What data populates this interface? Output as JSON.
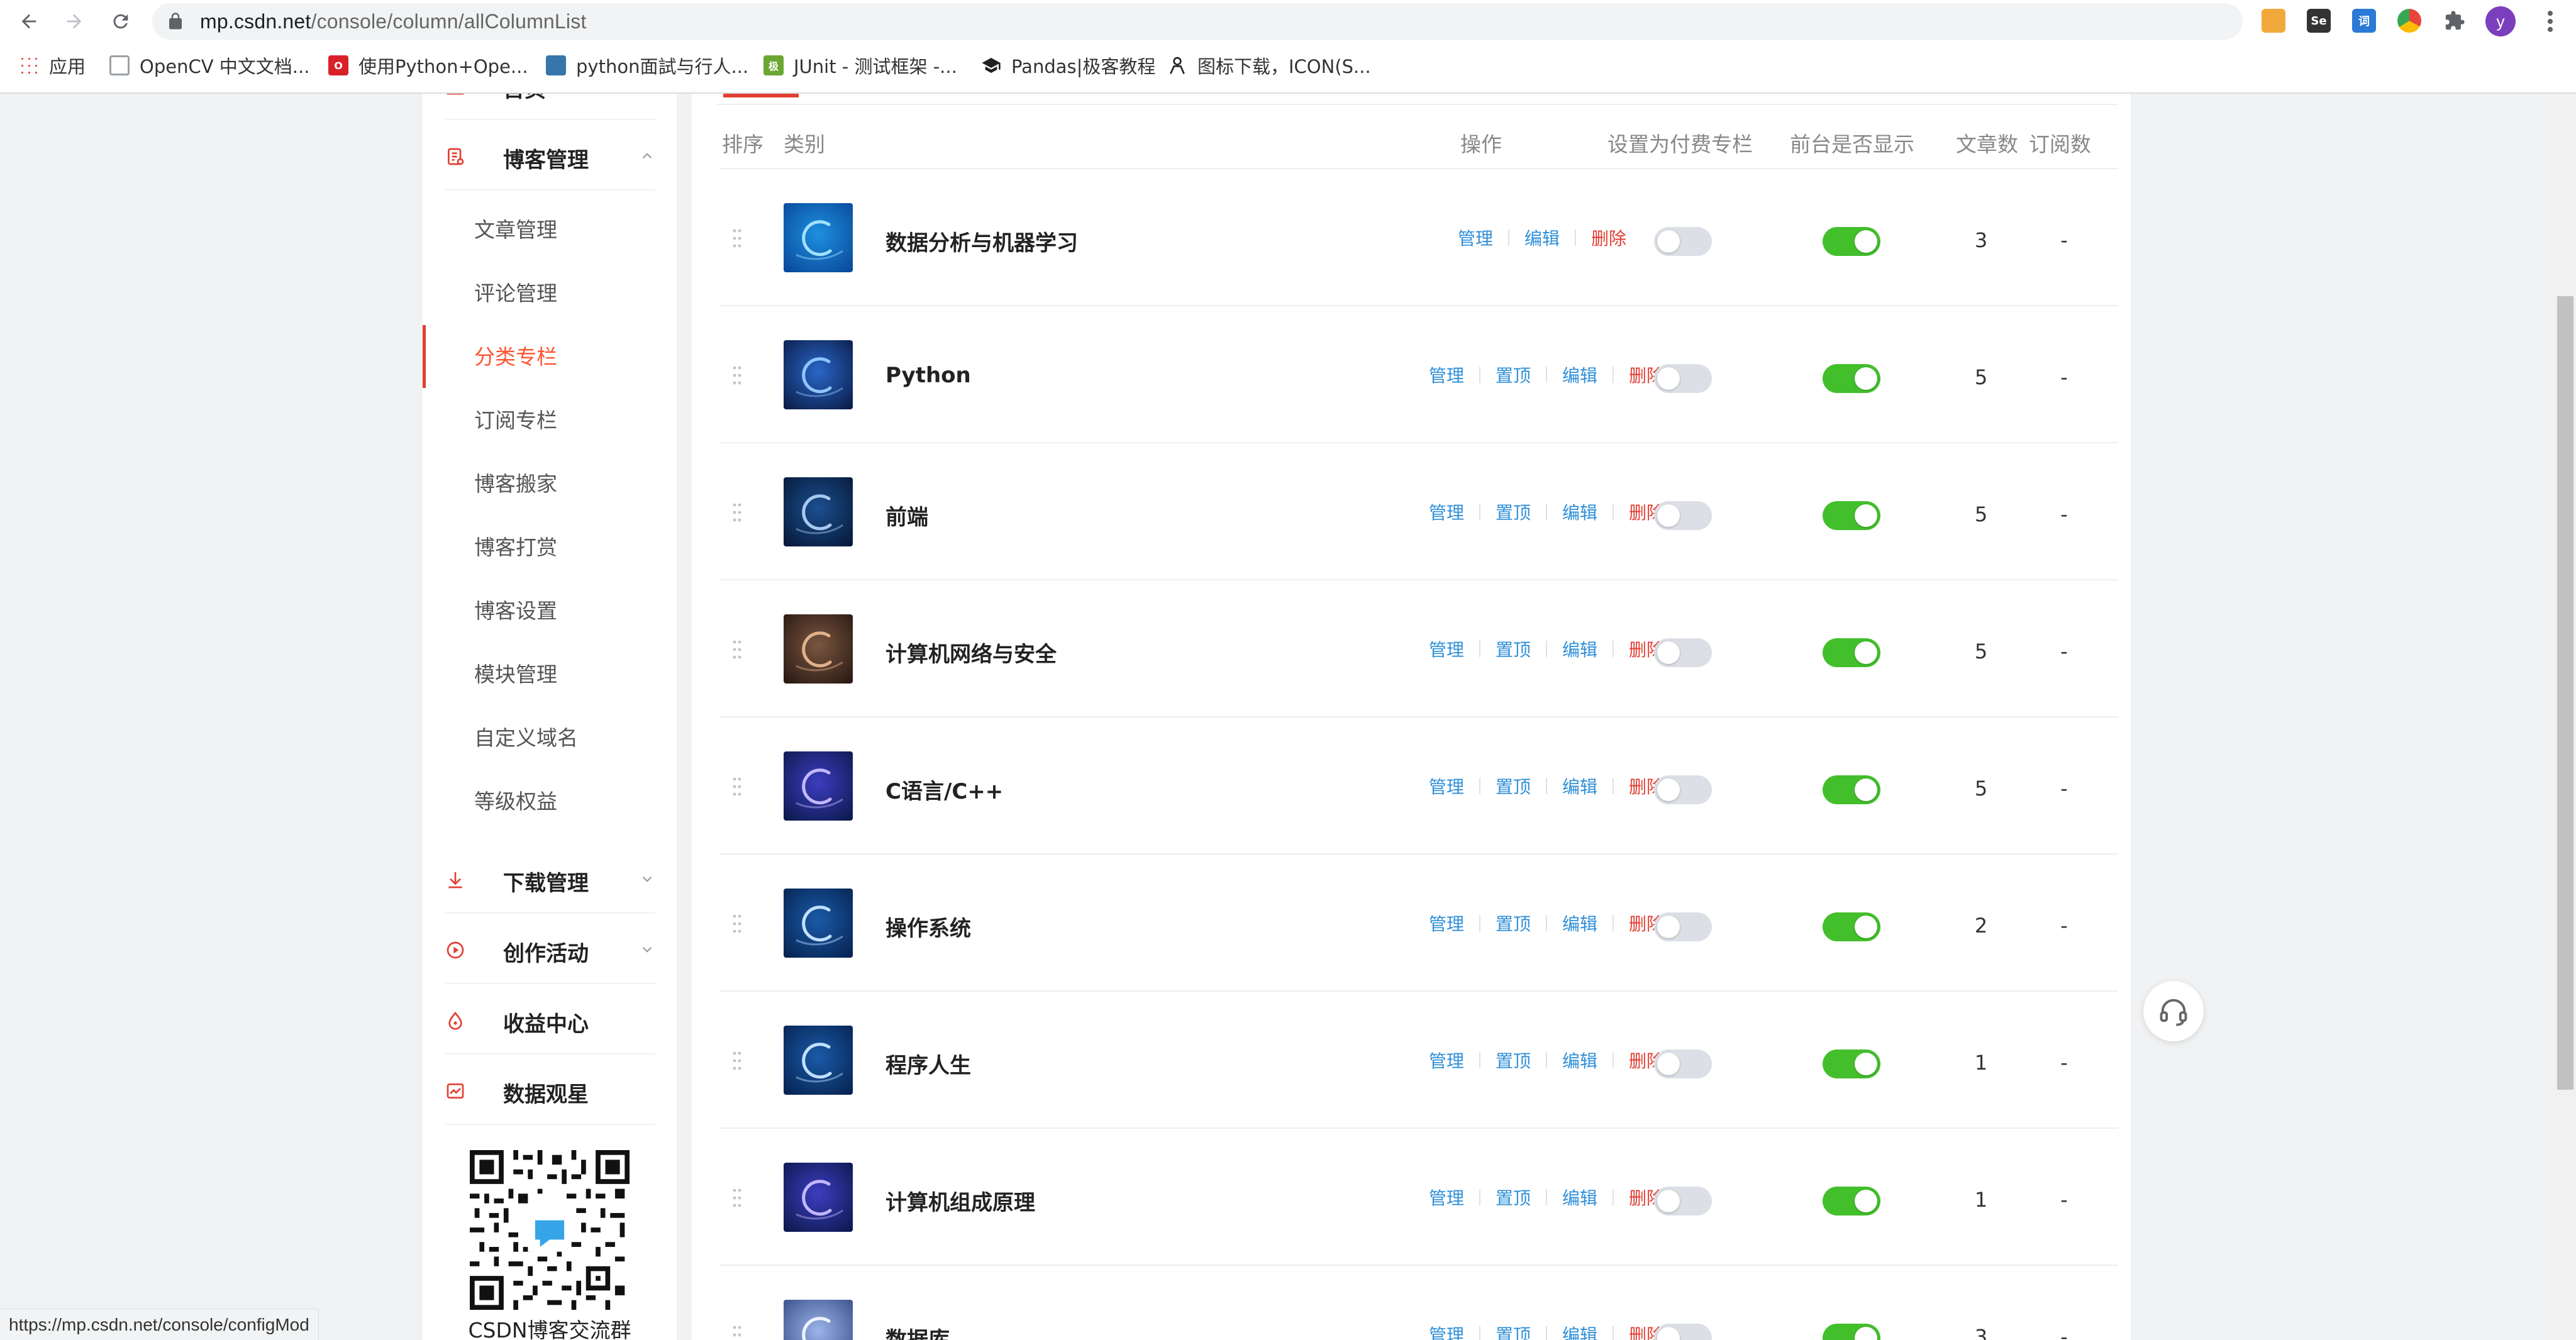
{
  "browser": {
    "url_domain": "mp.csdn.net",
    "url_path": "/console/column/allColumnList",
    "profile_initial": "y",
    "extensions": [
      {
        "name": "shield-extension-icon",
        "color": "#f2a93b",
        "label": ""
      },
      {
        "name": "selenium-extension-icon",
        "color": "#333333",
        "label": "Se"
      },
      {
        "name": "dict-extension-icon",
        "color": "#2a7ad6",
        "label": "词"
      },
      {
        "name": "chrome-colors-extension-icon",
        "color": "#e8453c",
        "label": ""
      },
      {
        "name": "puzzle-extension-icon",
        "color": "#5f6368",
        "label": ""
      }
    ]
  },
  "bookmarks": [
    {
      "label": "应用",
      "icon": "apps-grid-icon",
      "color": "#e8453c"
    },
    {
      "label": "OpenCV 中文文档...",
      "icon": "opencv-icon",
      "color": "#9aa0a6"
    },
    {
      "label": "使用Python+Ope...",
      "icon": "oreilly-icon",
      "color": "#d9202a"
    },
    {
      "label": "python面試与行人...",
      "icon": "python-icon",
      "color": "#3776ab"
    },
    {
      "label": "JUnit - 测试框架 -...",
      "icon": "junit-icon",
      "color": "#6aa632"
    },
    {
      "label": "Pandas|极客教程",
      "icon": "grad-cap-icon",
      "color": "#222222"
    },
    {
      "label": "图标下载，ICON(S...",
      "icon": "icon-site-icon",
      "color": "#222222"
    }
  ],
  "sidebar": {
    "home_label": "首页",
    "blog_mgmt": "博客管理",
    "sub_items": [
      "文章管理",
      "评论管理",
      "分类专栏",
      "订阅专栏",
      "博客搬家",
      "博客打赏",
      "博客设置",
      "模块管理",
      "自定义域名",
      "等级权益"
    ],
    "active_sub": "分类专栏",
    "download_mgmt": "下载管理",
    "creation_activity": "创作活动",
    "income_center": "收益中心",
    "data_watch": "数据观星",
    "qr_caption": "CSDN博客交流群",
    "accent": "#e33e33"
  },
  "table": {
    "headers": {
      "order": "排序",
      "category": "类别",
      "actions": "操作",
      "paid": "设置为付费专栏",
      "visible": "前台是否显示",
      "articles": "文章数",
      "subscribers": "订阅数"
    },
    "action_labels": {
      "manage": "管理",
      "pin": "置顶",
      "edit": "编辑",
      "delete": "删除"
    },
    "rows": [
      {
        "name": "数据分析与机器学习",
        "has_pin": false,
        "paid": false,
        "visible": true,
        "articles": "3",
        "subscribers": "-",
        "thumb": "swirl-blue"
      },
      {
        "name": "Python",
        "has_pin": true,
        "paid": false,
        "visible": true,
        "articles": "5",
        "subscribers": "-",
        "thumb": "vortex"
      },
      {
        "name": "前端",
        "has_pin": true,
        "paid": false,
        "visible": true,
        "articles": "5",
        "subscribers": "-",
        "thumb": "swirl-dark"
      },
      {
        "name": "计算机网络与安全",
        "has_pin": true,
        "paid": false,
        "visible": true,
        "articles": "5",
        "subscribers": "-",
        "thumb": "photo-brown"
      },
      {
        "name": "C语言/C++",
        "has_pin": true,
        "paid": false,
        "visible": true,
        "articles": "5",
        "subscribers": "-",
        "thumb": "swirl-purple"
      },
      {
        "name": "操作系统",
        "has_pin": true,
        "paid": false,
        "visible": true,
        "articles": "2",
        "subscribers": "-",
        "thumb": "swirl-navy"
      },
      {
        "name": "程序人生",
        "has_pin": true,
        "paid": false,
        "visible": true,
        "articles": "1",
        "subscribers": "-",
        "thumb": "swirl-navy"
      },
      {
        "name": "计算机组成原理",
        "has_pin": true,
        "paid": false,
        "visible": true,
        "articles": "1",
        "subscribers": "-",
        "thumb": "swirl-purple"
      },
      {
        "name": "数据库",
        "has_pin": true,
        "paid": false,
        "visible": true,
        "articles": "3",
        "subscribers": "-",
        "thumb": "swirl-light"
      }
    ],
    "link_color": "#2f8fd8",
    "delete_color": "#e33e33",
    "toggle_on_color": "#43bf2c",
    "toggle_off_color": "#dcdfe6"
  },
  "status_bar": "https://mp.csdn.net/console/configMod"
}
